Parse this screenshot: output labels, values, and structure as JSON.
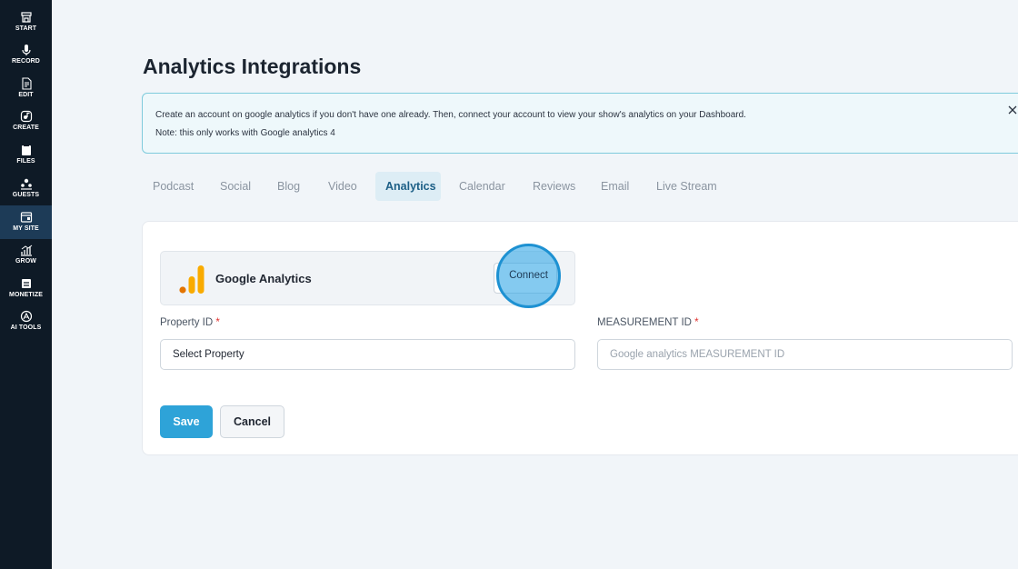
{
  "sidebar": {
    "items": [
      {
        "label": "START",
        "icon": "store-icon"
      },
      {
        "label": "RECORD",
        "icon": "microphone-icon"
      },
      {
        "label": "EDIT",
        "icon": "edit-file-icon"
      },
      {
        "label": "CREATE",
        "icon": "create-icon"
      },
      {
        "label": "FILES",
        "icon": "files-icon"
      },
      {
        "label": "GUESTS",
        "icon": "guests-icon"
      },
      {
        "label": "MY SITE",
        "icon": "website-icon"
      },
      {
        "label": "GROW",
        "icon": "growth-chart-icon"
      },
      {
        "label": "MONETIZE",
        "icon": "monetize-icon"
      },
      {
        "label": "AI TOOLS",
        "icon": "ai-tools-icon"
      }
    ],
    "active": "MY SITE",
    "colors": {
      "background": "#0e1a26",
      "active": "#1d3b57"
    }
  },
  "page": {
    "title": "Analytics Integrations"
  },
  "info": {
    "line1": "Create an account on google analytics if you don't have one already. Then, connect your account to view your show's analytics on your Dashboard.",
    "line2": "Note: this only works with Google analytics 4",
    "close_icon": "close-icon"
  },
  "tabs": [
    {
      "label": "Podcast"
    },
    {
      "label": "Social"
    },
    {
      "label": "Blog"
    },
    {
      "label": "Video"
    },
    {
      "label": "Analytics"
    },
    {
      "label": "Calendar"
    },
    {
      "label": "Reviews"
    },
    {
      "label": "Email"
    },
    {
      "label": "Live Stream"
    }
  ],
  "active_tab": "Analytics",
  "integration": {
    "name": "Google Analytics",
    "logo_icon": "google-analytics-icon",
    "connect_label": "Connect"
  },
  "form": {
    "property_label": "Property ID",
    "property_value": "Select Property",
    "measurement_label": "MEASUREMENT ID",
    "measurement_placeholder": "Google analytics MEASUREMENT ID",
    "required_mark": "*"
  },
  "actions": {
    "save_label": "Save",
    "cancel_label": "Cancel"
  },
  "colors": {
    "accent": "#2ea3d8",
    "required": "#e0322f",
    "ga_orange": "#f9ab00",
    "ga_dark_orange": "#e37400"
  }
}
